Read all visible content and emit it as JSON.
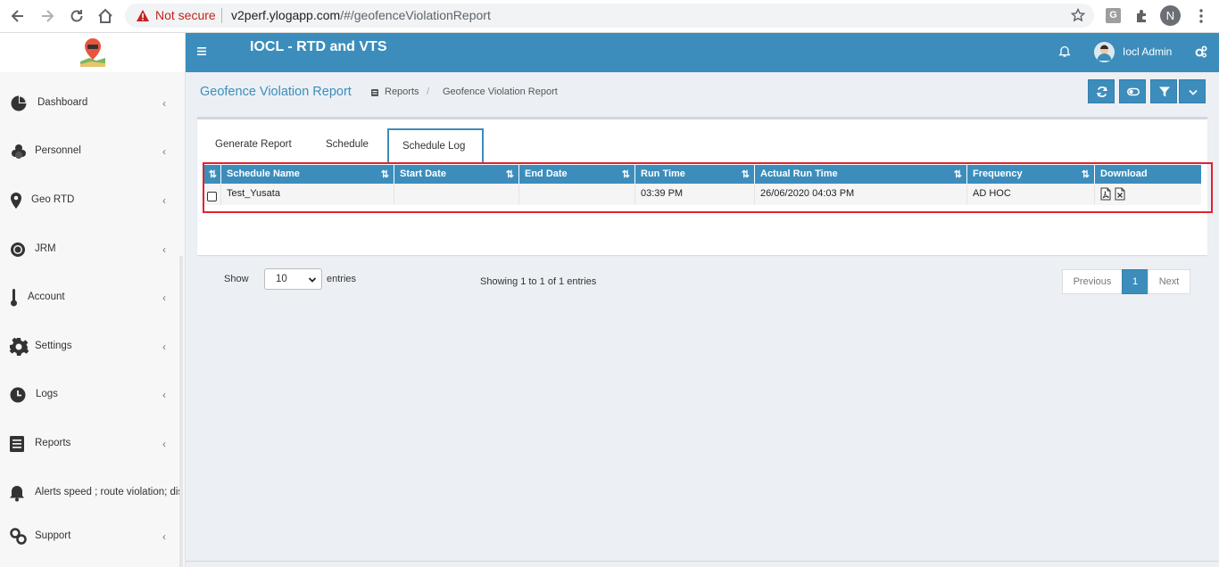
{
  "browser": {
    "not_secure": "Not secure",
    "url_host": "v2perf.ylogapp.com",
    "url_path": "/#/geofenceViolationReport",
    "ext_letter": "G",
    "profile_letter": "N"
  },
  "sidebar": {
    "items": [
      {
        "label": "Dashboard",
        "icon": "pie-chart-icon"
      },
      {
        "label": "Personnel",
        "icon": "users-icon"
      },
      {
        "label": "Geo RTD",
        "icon": "map-marker-icon"
      },
      {
        "label": "JRM",
        "icon": "gear-icon"
      },
      {
        "label": "Account",
        "icon": "thermometer-icon"
      },
      {
        "label": "Settings",
        "icon": "cog-icon"
      },
      {
        "label": "Logs",
        "icon": "clock-icon"
      },
      {
        "label": "Reports",
        "icon": "book-icon"
      },
      {
        "label": "Alerts speed ; route violation; dis",
        "icon": "bell-icon"
      },
      {
        "label": "Support",
        "icon": "chain-icon"
      }
    ]
  },
  "header": {
    "title": "IOCL - RTD and VTS",
    "user_name": "Iocl Admin"
  },
  "page": {
    "title": "Geofence Violation Report",
    "breadcrumb": [
      "Reports",
      "Geofence Violation Report"
    ],
    "breadcrumb_sep": "/"
  },
  "tabs": [
    {
      "label": "Generate Report",
      "active": false
    },
    {
      "label": "Schedule",
      "active": false
    },
    {
      "label": "Schedule Log",
      "active": true
    }
  ],
  "table": {
    "columns": [
      "Schedule Name",
      "Start Date",
      "End Date",
      "Run Time",
      "Actual Run Time",
      "Frequency",
      "Download"
    ],
    "rows": [
      {
        "schedule_name": "Test_Yusata",
        "start_date": "",
        "end_date": "",
        "run_time": "03:39 PM",
        "actual_run_time": "26/06/2020 04:03 PM",
        "frequency": "AD HOC"
      }
    ]
  },
  "pagination": {
    "show_label": "Show",
    "page_size": "10",
    "entries_label": "entries",
    "info": "Showing 1 to 1 of 1 entries",
    "previous": "Previous",
    "current_page": "1",
    "next": "Next"
  },
  "colors": {
    "primary": "#3c8dbc",
    "highlight": "#e0232f",
    "content_bg": "#ecf0f5"
  }
}
